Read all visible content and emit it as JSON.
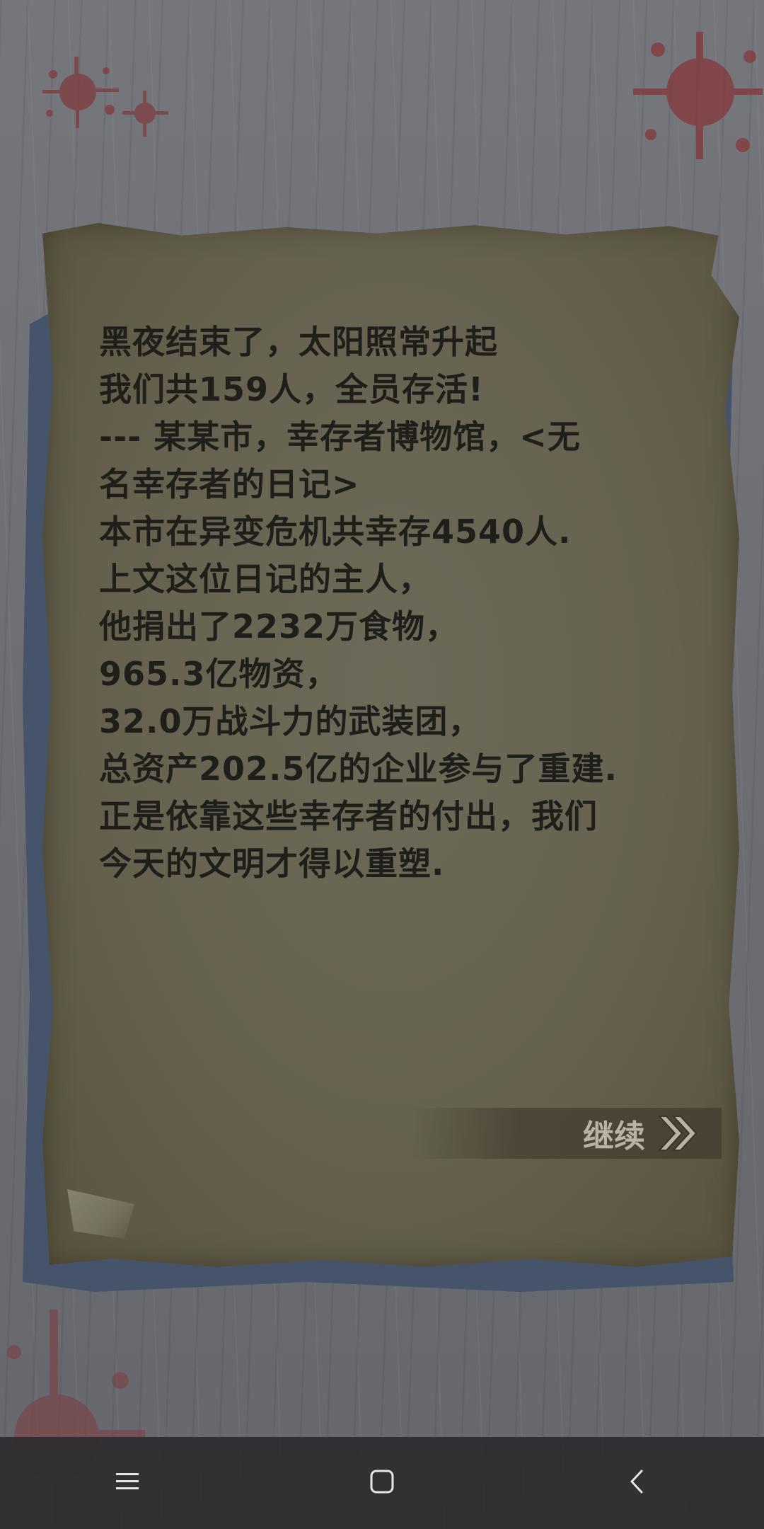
{
  "diary": {
    "lines": [
      "黑夜结束了，太阳照常升起",
      "我们共159人，全员存活!",
      "---  某某市，幸存者博物馆，<无",
      "名幸存者的日记>",
      "本市在异变危机共幸存4540人.",
      "上文这位日记的主人，",
      "他捐出了2232万食物，",
      "965.3亿物资，",
      "32.0万战斗力的武装团，",
      "总资产202.5亿的企业参与了重建.",
      "正是依靠这些幸存者的付出，我们",
      "今天的文明才得以重塑."
    ]
  },
  "continue_button": {
    "label": "继续",
    "icon": "double-chevron-right-icon"
  },
  "nav_bar": {
    "menu_icon": "menu-icon",
    "home_icon": "home-icon",
    "back_icon": "back-icon"
  },
  "colors": {
    "paper": "#66624f",
    "text": "#1f1e1a",
    "blood": "#8a3a3e",
    "background": "#6f7176",
    "nav_bar": "#2d2d30"
  }
}
